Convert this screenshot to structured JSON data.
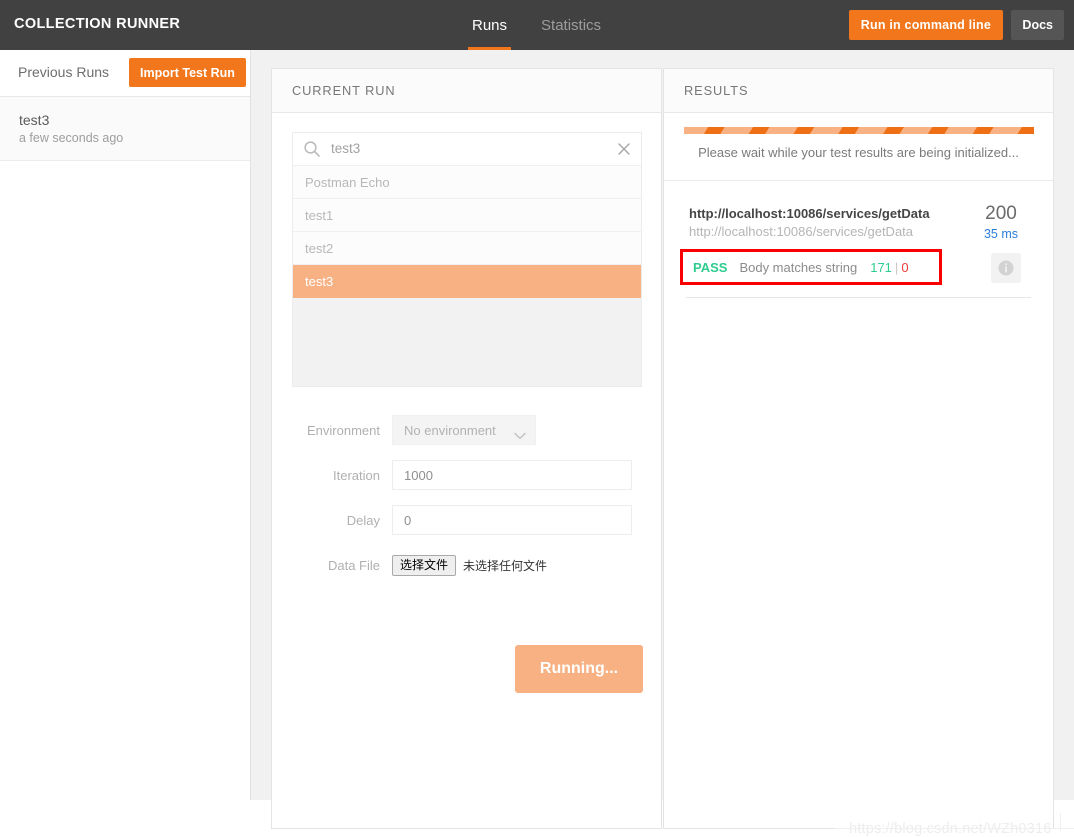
{
  "header": {
    "app_title": "COLLECTION RUNNER",
    "tabs": [
      {
        "label": "Runs",
        "active": true
      },
      {
        "label": "Statistics",
        "active": false
      }
    ],
    "run_command_label": "Run in command line",
    "docs_label": "Docs",
    "accent_color": "#f2761b",
    "bar_color": "#414141"
  },
  "sidebar": {
    "title": "Previous Runs",
    "import_label": "Import Test Run",
    "runs": [
      {
        "name": "test3",
        "time": "a few seconds ago"
      }
    ]
  },
  "current_run": {
    "panel_title": "CURRENT RUN",
    "search": {
      "value": "test3",
      "search_icon": "search-icon",
      "clear_icon": "close-icon"
    },
    "suggestions": [
      {
        "label": "Postman Echo",
        "selected": false
      },
      {
        "label": "test1",
        "selected": false
      },
      {
        "label": "test2",
        "selected": false
      },
      {
        "label": "test3",
        "selected": true
      }
    ],
    "form": {
      "environment_label": "Environment",
      "environment_value": "No environment",
      "iteration_label": "Iteration",
      "iteration_value": "1000",
      "delay_label": "Delay",
      "delay_value": "0",
      "data_file_label": "Data File",
      "data_file_button": "选择文件",
      "data_file_status": "未选择任何文件"
    },
    "run_button_label": "Running...",
    "run_button_color": "#f7b183"
  },
  "results": {
    "panel_title": "RESULTS",
    "wait_text": "Please wait while your test results are being initialized...",
    "progress_colors": {
      "dark": "#ee6f14",
      "light": "#f7b183"
    },
    "rows": [
      {
        "url_main": "http://localhost:10086/services/getData",
        "url_sub": "http://localhost:10086/services/getData",
        "assertion_status": "PASS",
        "assertion_name": "Body matches string",
        "pass_count": "171",
        "separator": "|",
        "fail_count": "0",
        "status_code": "200",
        "response_time": "35 ms",
        "info_icon": "info-icon",
        "highlight_color": "#fb0000",
        "pass_color": "#2ecc8e",
        "fail_color": "#ee3b3b",
        "time_color": "#2a7ddd"
      }
    ]
  },
  "watermark": {
    "text": "https://blog.csdn.net/WZh0316"
  }
}
